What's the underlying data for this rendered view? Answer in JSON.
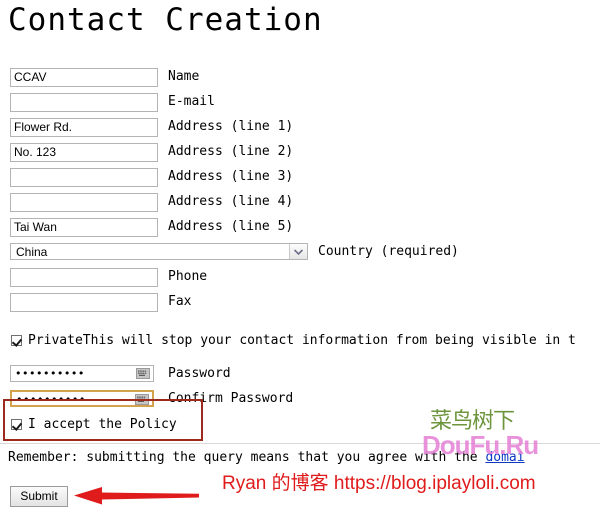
{
  "page": {
    "title": "Contact Creation"
  },
  "form": {
    "fields": [
      {
        "name": "name",
        "value": "CCAV",
        "label": "Name"
      },
      {
        "name": "email",
        "value": "",
        "label": "E-mail"
      },
      {
        "name": "address1",
        "value": "Flower Rd.",
        "label": "Address (line 1)"
      },
      {
        "name": "address2",
        "value": "No. 123",
        "label": "Address (line 2)"
      },
      {
        "name": "address3",
        "value": "",
        "label": "Address (line 3)"
      },
      {
        "name": "address4",
        "value": "",
        "label": "Address (line 4)"
      },
      {
        "name": "address5",
        "value": "Tai Wan",
        "label": "Address (line 5)"
      }
    ],
    "country": {
      "value": "China",
      "label": "Country (required)",
      "options": [
        "China"
      ]
    },
    "phone": {
      "value": "",
      "label": "Phone"
    },
    "fax": {
      "value": "",
      "label": "Fax"
    },
    "private": {
      "checked": true,
      "label": "Private",
      "description": "This will stop your contact information from being visible in t"
    },
    "password": {
      "value": "••••••••••",
      "label": "Password",
      "icon": "keyboard-icon"
    },
    "confirm_password": {
      "value": "••••••••••",
      "label": "Confirm Password",
      "icon": "keyboard-icon",
      "highlight_color": "#d2a24c"
    },
    "accept_policy": {
      "checked": true,
      "label": "I accept the Policy"
    }
  },
  "footer": {
    "remember_text": "Remember: submitting the query means that you agree with the ",
    "remember_link": "domai",
    "submit_label": "Submit"
  },
  "annotations": {
    "box_color": "#9c2a1e",
    "arrow_color": "#e01b1b"
  },
  "watermarks": {
    "logo_text": "菜鸟树下",
    "logo_sub": "DouFu.Ru",
    "blog_text": "Ryan 的博客 https://blog.iplayloli.com"
  }
}
